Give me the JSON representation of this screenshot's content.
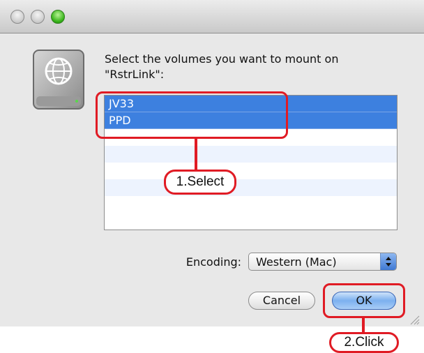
{
  "window": {
    "buttons": [
      "close",
      "minimize",
      "zoom"
    ]
  },
  "dialog": {
    "icon": "network-drive-icon",
    "prompt_line1": "Select the volumes you want to mount on",
    "prompt_line2": "\"RstrLink\":",
    "volumes": [
      {
        "label": "JV33",
        "selected": true
      },
      {
        "label": "PPD",
        "selected": true
      },
      {
        "label": "",
        "selected": false
      },
      {
        "label": "",
        "selected": false
      },
      {
        "label": "",
        "selected": false
      },
      {
        "label": "",
        "selected": false
      },
      {
        "label": "",
        "selected": false
      }
    ],
    "encoding_label": "Encoding:",
    "encoding_value": "Western (Mac)",
    "cancel_label": "Cancel",
    "ok_label": "OK"
  },
  "annotations": {
    "step1": "1.Select",
    "step2": "2.Click",
    "color": "#e01b24"
  }
}
